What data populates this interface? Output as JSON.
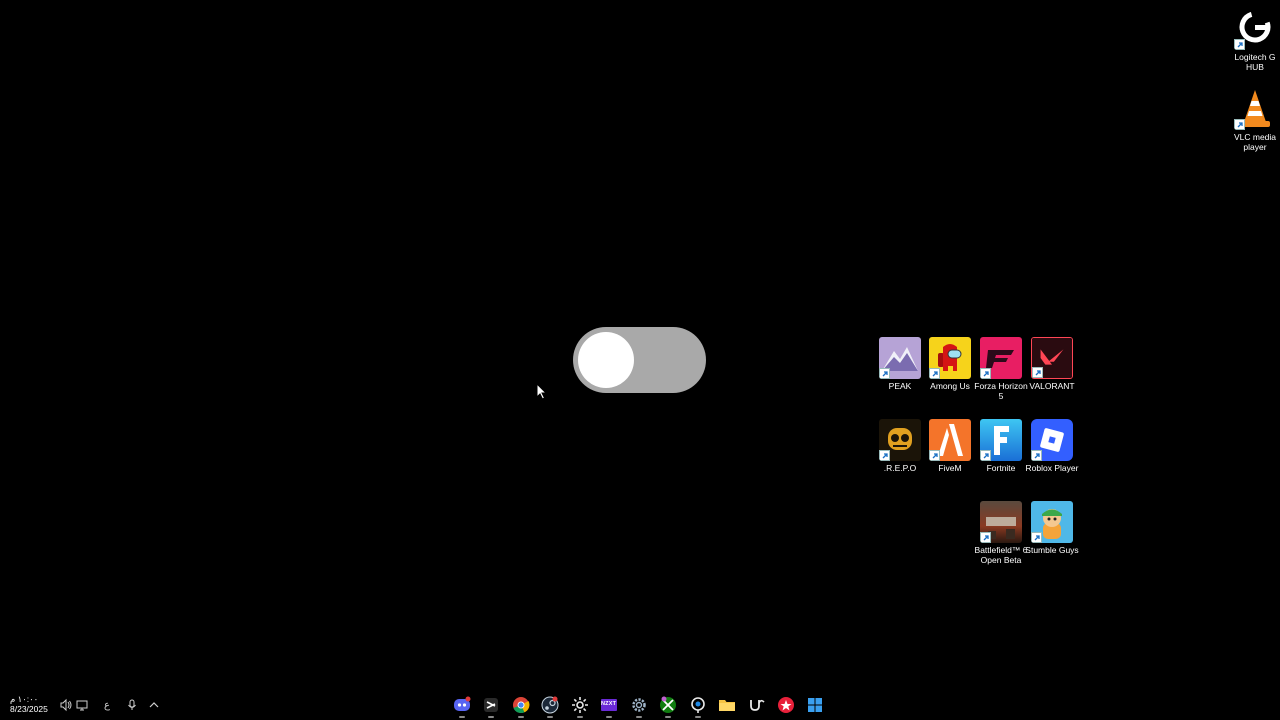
{
  "desktop": {
    "shortcuts_right": [
      {
        "name": "logitech",
        "label": "Logitech G HUB",
        "icon": "logitech-g-icon"
      },
      {
        "name": "vlc",
        "label": "VLC media player",
        "icon": "vlc-cone-icon"
      }
    ],
    "shortcuts_grid": [
      {
        "name": "peak",
        "label": "PEAK",
        "icon": "peak-mountain-icon"
      },
      {
        "name": "among-us",
        "label": "Among Us",
        "icon": "among-us-crewmate-icon"
      },
      {
        "name": "forza",
        "label": "Forza Horizon 5",
        "icon": "forza-icon"
      },
      {
        "name": "valorant",
        "label": "VALORANT",
        "icon": "valorant-icon"
      },
      {
        "name": "repo",
        "label": ".R.E.P.O",
        "icon": "repo-robot-icon"
      },
      {
        "name": "fivem",
        "label": "FiveM",
        "icon": "fivem-icon"
      },
      {
        "name": "fortnite",
        "label": "Fortnite",
        "icon": "fortnite-f-icon"
      },
      {
        "name": "roblox",
        "label": "Roblox Player",
        "icon": "roblox-icon"
      },
      {
        "name": "battlefield",
        "label": "Battlefield™ 6 Open Beta",
        "icon": "battlefield-icon"
      },
      {
        "name": "stumble",
        "label": "Stumble Guys",
        "icon": "stumble-guys-icon"
      }
    ]
  },
  "toggle": {
    "state": "off",
    "track_color": "#a9a9a9",
    "knob_color": "#ffffff"
  },
  "taskbar": {
    "time": "١٠:٠٠ م",
    "date": "8/23/2025",
    "input_lang": "ع",
    "tray_icons": [
      "speaker-icon",
      "network-icon",
      "mic-icon",
      "chevron-up-icon"
    ],
    "apps": [
      "discord-icon",
      "capcut-icon",
      "chrome-icon",
      "steam-icon",
      "steelseries-icon",
      "nzxt-icon",
      "settings-gear-icon",
      "xbox-icon",
      "search-lens-icon",
      "file-explorer-icon",
      "uc-icon",
      "rockstar-icon",
      "windows-start-icon"
    ],
    "nzxt_text": "NZXT"
  }
}
